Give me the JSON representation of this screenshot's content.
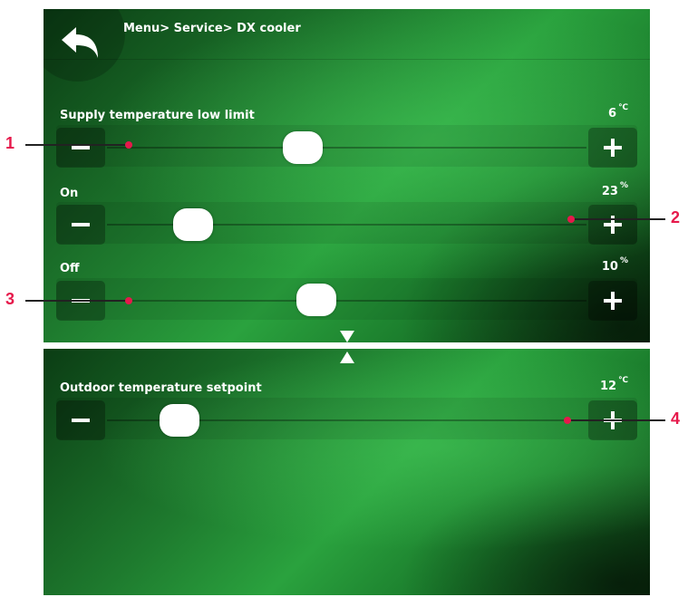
{
  "header": {
    "breadcrumb": "Menu> Service> DX cooler",
    "back_icon": "back-arrow-icon"
  },
  "settings": [
    {
      "label": "Supply temperature low limit",
      "value": "6",
      "unit": "℃",
      "slider_fraction": 0.4
    },
    {
      "label": "On",
      "value": "23",
      "unit": "%",
      "slider_fraction": 0.15
    },
    {
      "label": "Off",
      "value": "10",
      "unit": "%",
      "slider_fraction": 0.43
    }
  ],
  "page2": {
    "settings": [
      {
        "label": "Outdoor temperature setpoint",
        "value": "12",
        "unit": "℃",
        "slider_fraction": 0.12
      }
    ]
  },
  "callouts": [
    "1",
    "2",
    "3",
    "4"
  ],
  "colors": {
    "callout": "#e6194b",
    "background": "#1e7a2e"
  }
}
